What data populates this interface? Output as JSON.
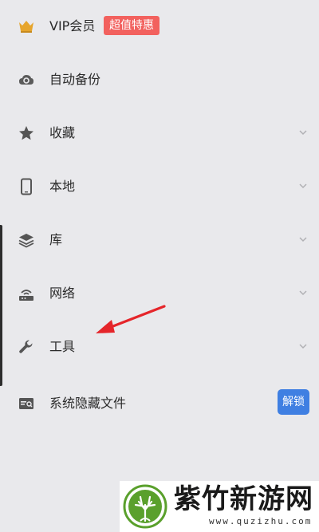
{
  "menu": {
    "vip": {
      "label": "VIP会员",
      "badge": "超值特惠",
      "icon": "crown-icon"
    },
    "backup": {
      "label": "自动备份",
      "icon": "cloud-sync-icon"
    },
    "favorites": {
      "label": "收藏",
      "icon": "star-icon"
    },
    "local": {
      "label": "本地",
      "icon": "phone-icon"
    },
    "library": {
      "label": "库",
      "icon": "layers-icon"
    },
    "network": {
      "label": "网络",
      "icon": "router-icon"
    },
    "tools": {
      "label": "工具",
      "icon": "wrench-icon"
    },
    "hidden_files": {
      "label": "系统隐藏文件",
      "button": "解锁",
      "icon": "hidden-folder-icon"
    }
  },
  "watermark": {
    "name": "紫竹新游网",
    "url": "www.quzizhu.com"
  },
  "colors": {
    "background": "#e9e9ec",
    "badge": "#f2615e",
    "unlock": "#3f7fe2",
    "arrow": "#e5252a",
    "crown": "#e6a52d"
  }
}
